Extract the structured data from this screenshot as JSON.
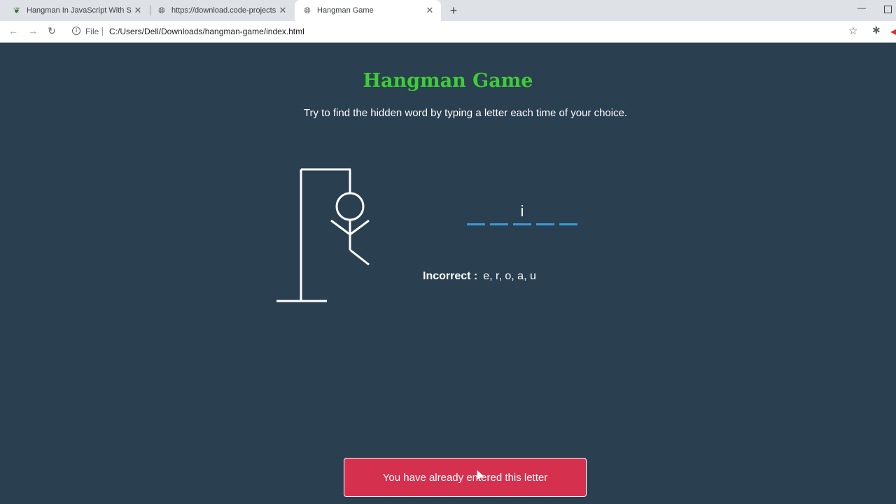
{
  "browser": {
    "tabs": [
      {
        "title": "Hangman In JavaScript With Sou",
        "icon": "leaf-icon",
        "active": false
      },
      {
        "title": "https://download.code-projects.o",
        "icon": "globe-icon",
        "active": false
      },
      {
        "title": "Hangman Game",
        "icon": "globe-icon",
        "active": true
      }
    ],
    "file_label": "File",
    "url": "C:/Users/Dell/Downloads/hangman-game/index.html"
  },
  "game": {
    "title": "Hangman Game",
    "subtitle": "Try to find the hidden word by typing a letter each time of your choice.",
    "word": [
      "",
      "",
      "i",
      "",
      ""
    ],
    "incorrect_label": "Incorrect :",
    "incorrect_letters": "e, r, o, a, u",
    "notification": "You have already entered this letter",
    "wrong_count": 5
  },
  "colors": {
    "background": "#2a3f50",
    "title": "#3ecc35",
    "underline": "#3a9ad9",
    "notification": "#d6304f"
  }
}
